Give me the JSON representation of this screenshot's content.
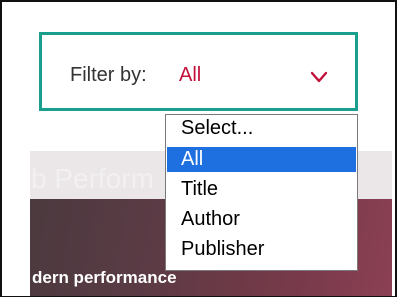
{
  "filter": {
    "label": "Filter by:",
    "selected_value": "All",
    "accent_color": "#1a9e8e",
    "value_color": "#c3103a"
  },
  "dropdown": {
    "options": [
      "Select...",
      "All",
      "Title",
      "Author",
      "Publisher"
    ],
    "highlighted": "All",
    "highlight_color": "#1e6fe0"
  },
  "banner": {
    "title_partial": "b Perform",
    "subtitle_partial": "dern performance"
  },
  "icons": {
    "chevron": "chevron-down-icon"
  }
}
